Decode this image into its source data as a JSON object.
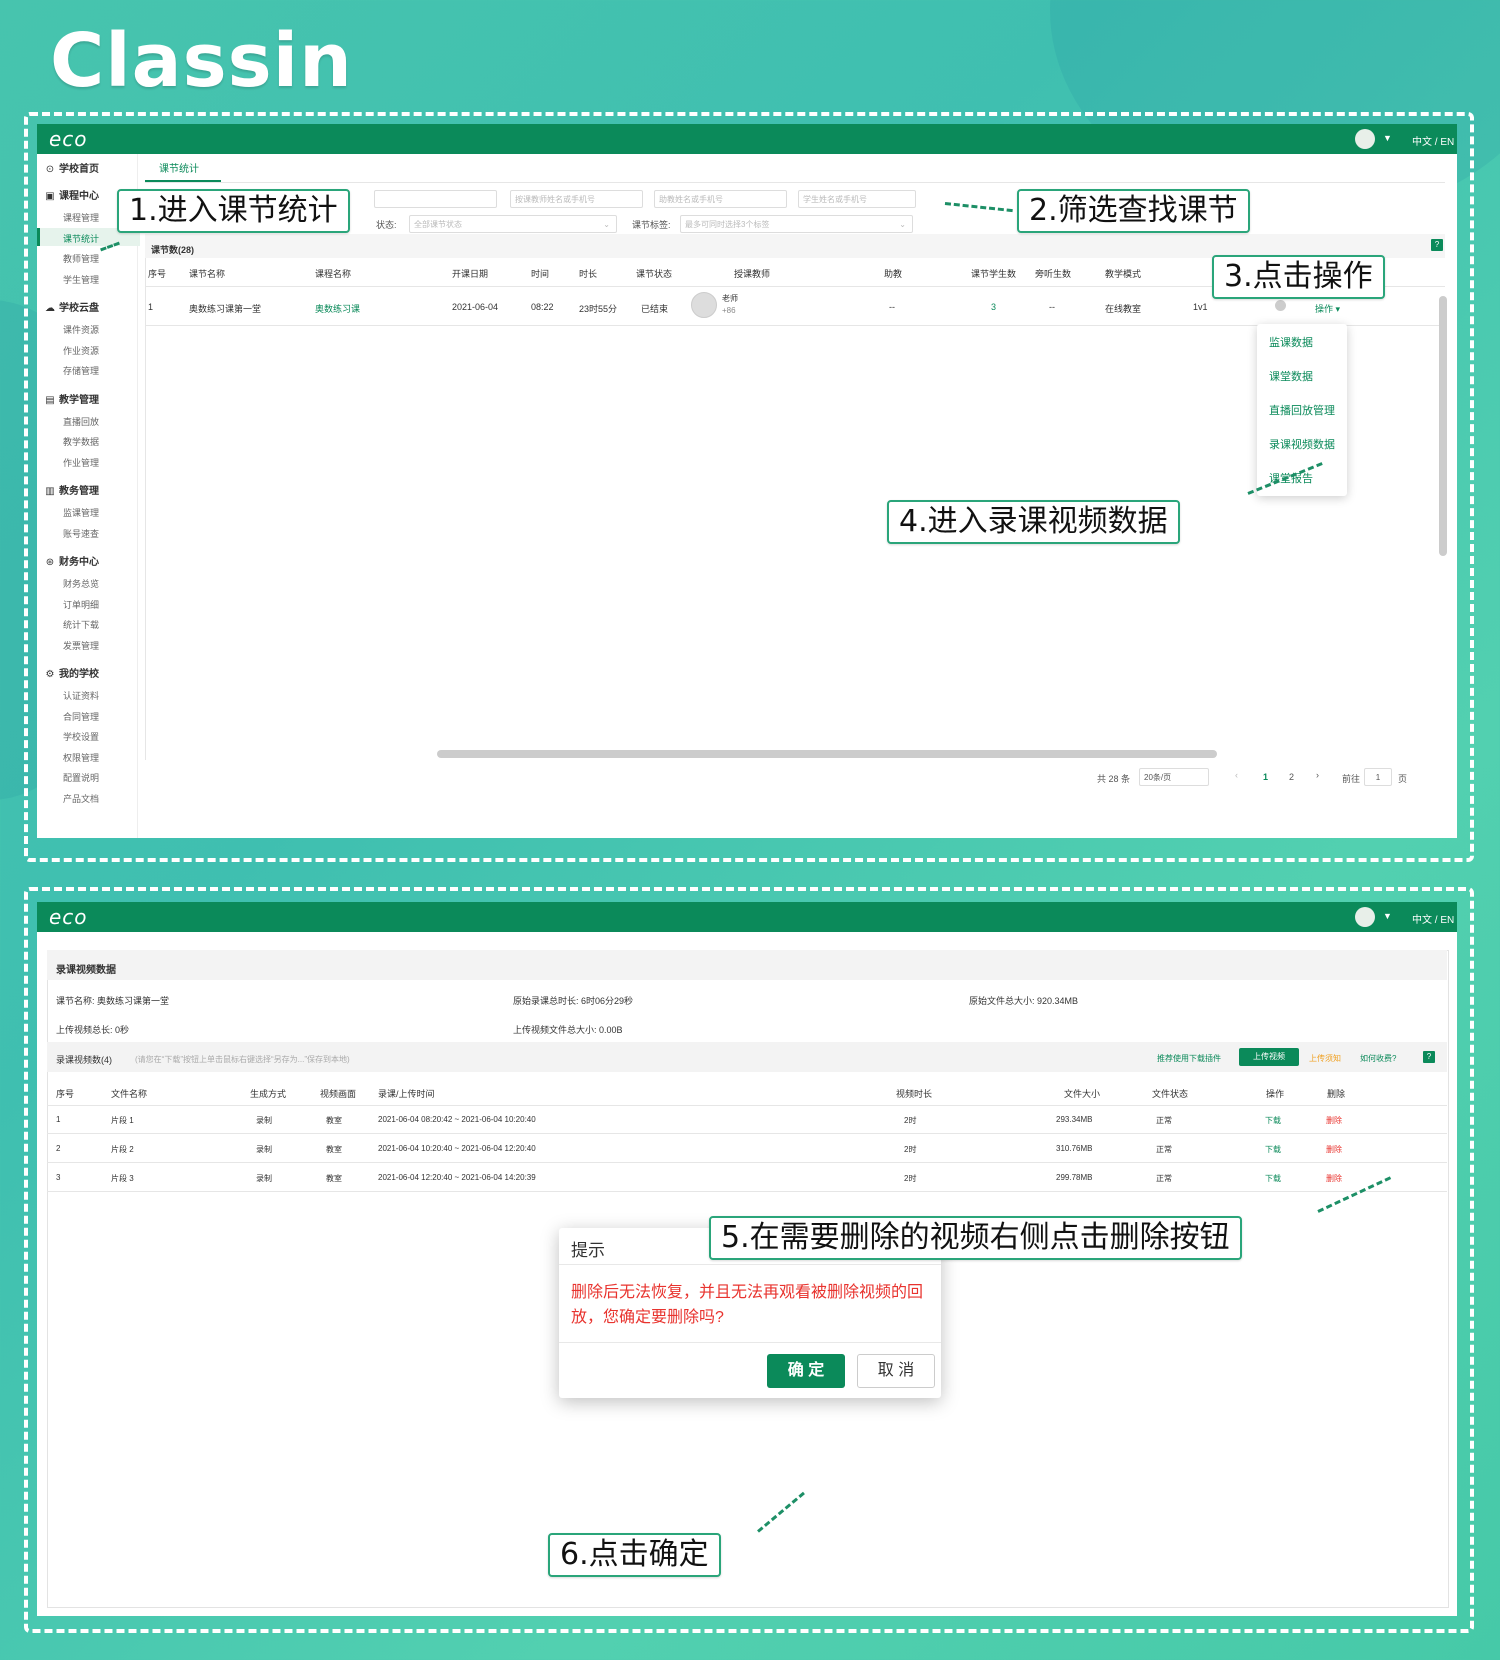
{
  "logo": "Classin",
  "app_brand": "eco",
  "lang_switch": "中文 / EN",
  "top": {
    "sidebar": [
      {
        "label": "学校首页",
        "icon": "⊙",
        "items": []
      },
      {
        "label": "课程中心",
        "icon": "▣",
        "items": [
          "课程管理",
          "课节统计",
          "教师管理",
          "学生管理"
        ]
      },
      {
        "label": "学校云盘",
        "icon": "☁",
        "items": [
          "课件资源",
          "作业资源",
          "存储管理"
        ]
      },
      {
        "label": "教学管理",
        "icon": "▤",
        "items": [
          "直播回放",
          "教学数据",
          "作业管理"
        ]
      },
      {
        "label": "教务管理",
        "icon": "▥",
        "items": [
          "监课管理",
          "账号速查"
        ]
      },
      {
        "label": "财务中心",
        "icon": "⊛",
        "items": [
          "财务总览",
          "订单明细",
          "统计下载",
          "发票管理"
        ]
      },
      {
        "label": "我的学校",
        "icon": "⚙",
        "items": [
          "认证资料",
          "合同管理",
          "学校设置",
          "权限管理",
          "配置说明",
          "产品文档"
        ]
      }
    ],
    "active_item": "课节统计",
    "tab": "课节统计",
    "filters": {
      "teacher_ph": "按课教师姓名或手机号",
      "assistant_ph": "助教姓名或手机号",
      "student_ph": "学生姓名或手机号",
      "status_label": "状态:",
      "status_ph": "全部课节状态",
      "tag_label": "课节标签:",
      "tag_ph": "最多可同时选择3个标签"
    },
    "count_label": "课节数(28)",
    "columns": [
      "序号",
      "课节名称",
      "课程名称",
      "开课日期",
      "时间",
      "时长",
      "课节状态",
      "授课教师",
      "助教",
      "课节学生数",
      "旁听生数",
      "教学模式",
      "作"
    ],
    "row": {
      "no": "1",
      "lesson": "奥数练习课第一堂",
      "course": "奥数练习课",
      "date": "2021-06-04",
      "time": "08:22",
      "duration": "23时55分",
      "status": "已结束",
      "teacher_name": "老师",
      "teacher_phone": "+86",
      "assistant": "--",
      "students": "3",
      "auditors": "--",
      "mode": "在线教室",
      "type": "1v1",
      "op": "操作 ▾"
    },
    "menu": [
      "监课数据",
      "课堂数据",
      "直播回放管理",
      "录课视频数据",
      "课堂报告"
    ],
    "pagination": {
      "total": "共 28 条",
      "per_page": "20条/页",
      "p1": "1",
      "p2": "2",
      "goto": "前往",
      "page_val": "1",
      "page_unit": "页",
      "prev": "‹",
      "next": "›"
    }
  },
  "callouts": {
    "c1": "1.进入课节统计",
    "c2": "2.筛选查找课节",
    "c3": "3.点击操作",
    "c4": "4.进入录课视频数据",
    "c5": "5.在需要删除的视频右侧点击删除按钮",
    "c6": "6.点击确定"
  },
  "bottom": {
    "title": "录课视频数据",
    "info": {
      "lesson": "课节名称: 奥数练习课第一堂",
      "orig_dur": "原始录课总时长: 6时06分29秒",
      "orig_size": "原始文件总大小: 920.34MB",
      "up_dur": "上传视频总长: 0秒",
      "up_size": "上传视频文件总大小: 0.00B"
    },
    "list_label": "录课视频数(4)",
    "list_hint": "(请您在“下载”按钮上单击鼠标右键选择“另存为...”保存到本地)",
    "plugin": "推荐使用下载插件",
    "upload_btn": "上传视频",
    "upload_notice": "上传须知",
    "fee": "如何收费?",
    "columns": [
      "序号",
      "文件名称",
      "生成方式",
      "视频画面",
      "录课/上传时间",
      "视频时长",
      "文件大小",
      "文件状态",
      "操作",
      "删除"
    ],
    "rows": [
      {
        "no": "1",
        "name": "片段 1",
        "gen": "录制",
        "view": "教室",
        "time": "2021-06-04 08:20:42 ~ 2021-06-04 10:20:40",
        "dur": "2时",
        "size": "293.34MB",
        "status": "正常",
        "op": "下载",
        "del": "删除"
      },
      {
        "no": "2",
        "name": "片段 2",
        "gen": "录制",
        "view": "教室",
        "time": "2021-06-04 10:20:40 ~ 2021-06-04 12:20:40",
        "dur": "2时",
        "size": "310.76MB",
        "status": "正常",
        "op": "下载",
        "del": "删除"
      },
      {
        "no": "3",
        "name": "片段 3",
        "gen": "录制",
        "view": "教室",
        "time": "2021-06-04 12:20:40 ~ 2021-06-04 14:20:39",
        "dur": "2时",
        "size": "299.78MB",
        "status": "正常",
        "op": "下载",
        "del": "删除"
      }
    ],
    "dialog": {
      "title": "提示",
      "message": "删除后无法恢复，并且无法再观看被删除视频的回放，您确定要删除吗?",
      "confirm": "确 定",
      "cancel": "取 消"
    }
  },
  "colors": {
    "brand": "#0b8a5a",
    "danger": "#e8332e",
    "callout_border": "#2aa57a"
  }
}
